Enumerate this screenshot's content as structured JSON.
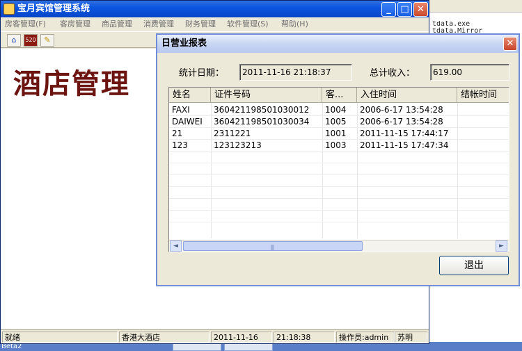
{
  "background": {
    "right_text": [
      "tdata.exe",
      "tdata.Mirror"
    ],
    "bottom_label": "Beta2"
  },
  "main_window": {
    "title": "宝月宾馆管理系统",
    "buttons": {
      "minimize": "_",
      "maximize": "□",
      "close": "✕"
    },
    "menu": [
      "房客管理(F)",
      "客房管理",
      "商品管理",
      "消费管理",
      "财务管理",
      "软件管理(S)",
      "帮助(H)"
    ],
    "toolbar_icons": [
      "home-icon",
      "report-icon",
      "keys-icon"
    ],
    "toolbar_glyphs": [
      "⌂",
      "520",
      "✎"
    ],
    "banner_text": "酒店管理",
    "status": {
      "state": "就绪",
      "hotel": "香港大酒店",
      "date": "2011-11-16",
      "time": "21:18:38",
      "operator": "操作员:admin",
      "operator_name": "苏明"
    },
    "colors": {
      "title_bar": "#0b55e0",
      "banner": "#6b1410"
    }
  },
  "dialog": {
    "title": "日营业报表",
    "close": "✕",
    "date_label": "统计日期：",
    "date_value": "2011-11-16 21:18:37",
    "income_label": "总计收入：",
    "income_value": "619.00",
    "columns": [
      "姓名",
      "证件号码",
      "客...",
      "入住时间",
      "结帐时间"
    ],
    "rows": [
      [
        "FAXI",
        "360421198501030012",
        "1004",
        "2006-6-17 13:54:28",
        ""
      ],
      [
        "DAIWEI",
        "360421198501030034",
        "1005",
        "2006-6-17 13:54:28",
        ""
      ],
      [
        "21",
        "2311221",
        "1001",
        "2011-11-15 17:44:17",
        ""
      ],
      [
        "123",
        "123123213",
        "1003",
        "2011-11-15 17:47:34",
        ""
      ]
    ],
    "scroll": {
      "left": "◄",
      "right": "►",
      "grip": "|||"
    },
    "exit_button": "退出"
  }
}
